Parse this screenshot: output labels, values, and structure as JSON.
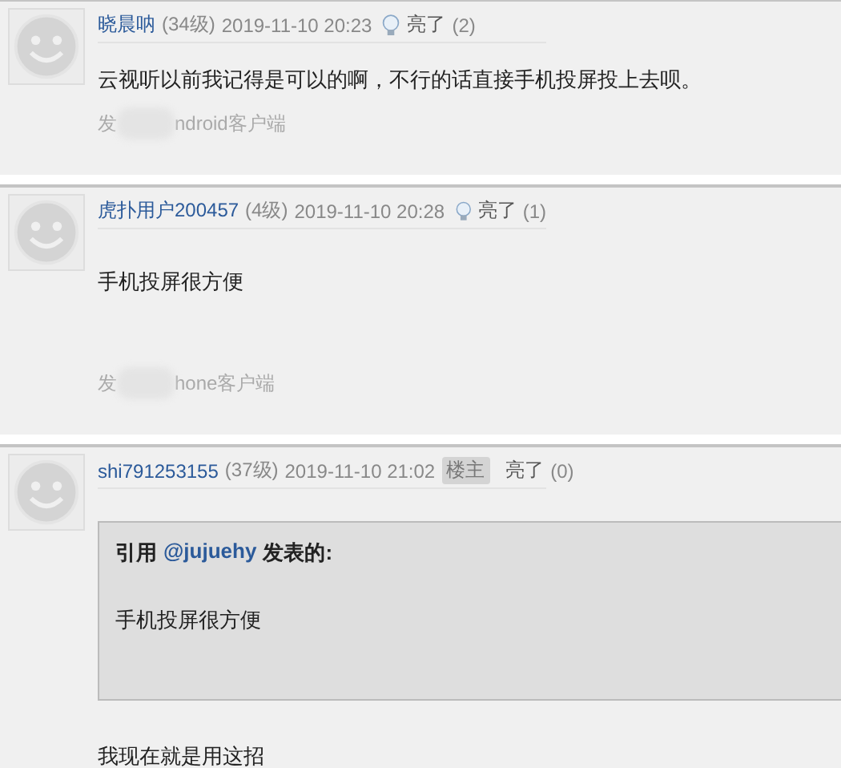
{
  "posts": [
    {
      "user": "晓晨呐",
      "level": "(34级)",
      "time": "2019-11-10 20:23",
      "likes_label": "亮了",
      "likes_count": "(2)",
      "content": "云视听以前我记得是可以的啊，不行的话直接手机投屏投上去呗。",
      "source_start": "发",
      "source_end": "ndroid客户端"
    },
    {
      "user": "虎扑用户200457",
      "level": "(4级)",
      "time": "2019-11-10 20:28",
      "likes_label": "亮了",
      "likes_count": "(1)",
      "content": "手机投屏很方便",
      "source_start": "发",
      "source_end": "hone客户端"
    },
    {
      "user": "shi791253155",
      "level": "(37级)",
      "time": "2019-11-10 21:02",
      "badge": "楼主",
      "likes_label": "亮了",
      "likes_count": "(0)",
      "quote": {
        "before": "引用",
        "user": "@jujuehy",
        "after": "**发表的**:",
        "text": "手机投屏很方便"
      },
      "content": "我现在就是用这招"
    }
  ]
}
